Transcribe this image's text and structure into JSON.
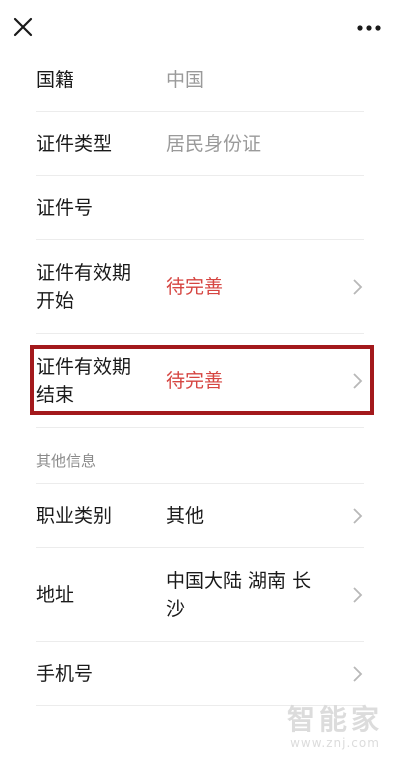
{
  "fields": {
    "nationality": {
      "label": "国籍",
      "value": "中国"
    },
    "id_type": {
      "label": "证件类型",
      "value": "居民身份证"
    },
    "id_number": {
      "label": "证件号",
      "value": ""
    },
    "valid_start": {
      "label_line1": "证件有效期",
      "label_line2": "开始",
      "value": "待完善"
    },
    "valid_end": {
      "label_line1": "证件有效期",
      "label_line2": "结束",
      "value": "待完善"
    }
  },
  "other_section": {
    "title": "其他信息",
    "occupation": {
      "label": "职业类别",
      "value": "其他"
    },
    "address": {
      "label": "地址",
      "value_line1": "中国大陆 湖南 长",
      "value_line2": "沙"
    },
    "phone": {
      "label": "手机号",
      "value": ""
    }
  },
  "watermark": {
    "title": "智能家",
    "url": "www.znj.com"
  },
  "colors": {
    "warning": "#d64541",
    "highlight_border": "#a3191c",
    "muted": "#9a9a9a"
  },
  "icons": {
    "close": "close-icon",
    "more": "more-icon",
    "chevron": "chevron-right-icon"
  }
}
